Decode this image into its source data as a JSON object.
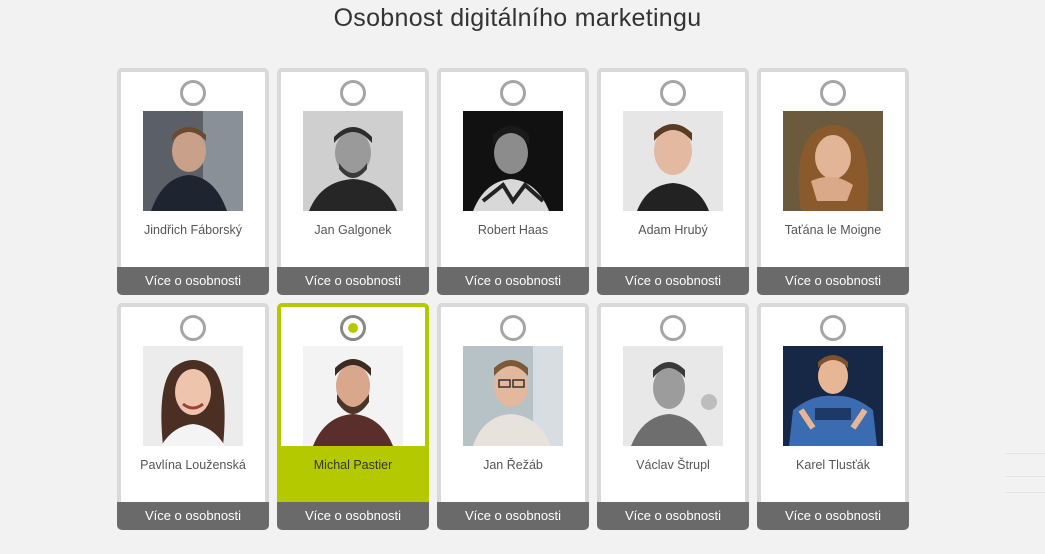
{
  "title": "Osobnost digitálního marketingu",
  "more_label": "Více o osobnosti",
  "accent_color": "#b5c900",
  "people": [
    {
      "name": "Jindřich Fáborský",
      "selected": false,
      "photo": "portrait-color"
    },
    {
      "name": "Jan Galgonek",
      "selected": false,
      "photo": "portrait-bw"
    },
    {
      "name": "Robert Haas",
      "selected": false,
      "photo": "portrait-dark"
    },
    {
      "name": "Adam Hrubý",
      "selected": false,
      "photo": "portrait-light"
    },
    {
      "name": "Taťána le Moigne",
      "selected": false,
      "photo": "portrait-warm"
    },
    {
      "name": "Pavlína Louženská",
      "selected": false,
      "photo": "portrait-light"
    },
    {
      "name": "Michal Pastier",
      "selected": true,
      "photo": "portrait-light"
    },
    {
      "name": "Jan Řežáb",
      "selected": false,
      "photo": "portrait-color"
    },
    {
      "name": "Václav Štrupl",
      "selected": false,
      "photo": "portrait-bw"
    },
    {
      "name": "Karel Tlusťák",
      "selected": false,
      "photo": "portrait-blue"
    }
  ]
}
